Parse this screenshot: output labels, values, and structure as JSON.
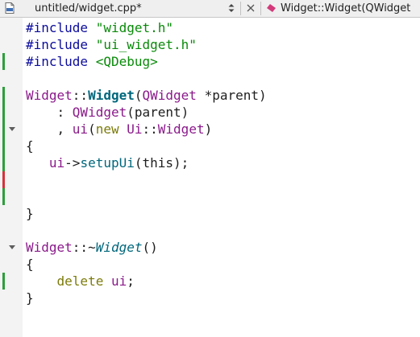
{
  "editor": {
    "document_title": "untitled/widget.cpp*",
    "current_symbol": "Widget::Widget(QWidget",
    "file_type_icon": "cpp-file-icon",
    "colors": {
      "saved_change": "#2e9e3c",
      "unsaved_change": "#d6323a",
      "preprocessor": "#0c0c9d",
      "string": "#0a8a0a",
      "type": "#8b1a8b",
      "function": "#00677c",
      "keyword": "#7b7b0a"
    }
  },
  "code": {
    "lines": [
      [
        {
          "t": "#include ",
          "c": "pp"
        },
        {
          "t": "\"widget.h\"",
          "c": "str"
        }
      ],
      [
        {
          "t": "#include ",
          "c": "pp"
        },
        {
          "t": "\"ui_widget.h\"",
          "c": "str"
        }
      ],
      [
        {
          "t": "#include ",
          "c": "pp"
        },
        {
          "t": "<QDebug>",
          "c": "inc"
        }
      ],
      [],
      [
        {
          "t": "Widget",
          "c": "cls"
        },
        {
          "t": "::",
          "c": "punct"
        },
        {
          "t": "Widget",
          "c": "fn-def"
        },
        {
          "t": "(",
          "c": "punct"
        },
        {
          "t": "QWidget",
          "c": "cls"
        },
        {
          "t": " *parent)",
          "c": "punct"
        }
      ],
      [
        {
          "t": "    : ",
          "c": "punct"
        },
        {
          "t": "QWidget",
          "c": "cls"
        },
        {
          "t": "(parent)",
          "c": "punct"
        }
      ],
      [
        {
          "t": "    , ",
          "c": "punct"
        },
        {
          "t": "ui",
          "c": "mem"
        },
        {
          "t": "(",
          "c": "punct"
        },
        {
          "t": "new",
          "c": "kw"
        },
        {
          "t": " ",
          "c": "punct"
        },
        {
          "t": "Ui",
          "c": "cls"
        },
        {
          "t": "::",
          "c": "punct"
        },
        {
          "t": "Widget",
          "c": "cls"
        },
        {
          "t": ")",
          "c": "punct"
        }
      ],
      [
        {
          "t": "{",
          "c": "punct"
        }
      ],
      [
        {
          "t": "   ",
          "c": "punct"
        },
        {
          "t": "ui",
          "c": "mem"
        },
        {
          "t": "->",
          "c": "punct"
        },
        {
          "t": "setupUi",
          "c": "call"
        },
        {
          "t": "(this);",
          "c": "punct"
        }
      ],
      [],
      [],
      [
        {
          "t": "}",
          "c": "punct"
        }
      ],
      [],
      [
        {
          "t": "Widget",
          "c": "cls"
        },
        {
          "t": "::~",
          "c": "punct"
        },
        {
          "t": "Widget",
          "c": "fn-dtor"
        },
        {
          "t": "()",
          "c": "punct"
        }
      ],
      [
        {
          "t": "{",
          "c": "punct"
        }
      ],
      [
        {
          "t": "    ",
          "c": "punct"
        },
        {
          "t": "delete",
          "c": "kw"
        },
        {
          "t": " ",
          "c": "punct"
        },
        {
          "t": "ui",
          "c": "mem"
        },
        {
          "t": ";",
          "c": "punct"
        }
      ],
      [
        {
          "t": "}",
          "c": "punct"
        }
      ]
    ],
    "change_marks": [
      {
        "line": 3,
        "state": "saved"
      },
      {
        "line": 5,
        "state": "saved"
      },
      {
        "line": 6,
        "state": "saved"
      },
      {
        "line": 7,
        "state": "saved"
      },
      {
        "line": 8,
        "state": "saved"
      },
      {
        "line": 9,
        "state": "saved"
      },
      {
        "line": 10,
        "state": "unsaved"
      },
      {
        "line": 11,
        "state": "saved"
      },
      {
        "line": 16,
        "state": "saved"
      }
    ],
    "fold_markers": [
      7,
      14
    ]
  }
}
